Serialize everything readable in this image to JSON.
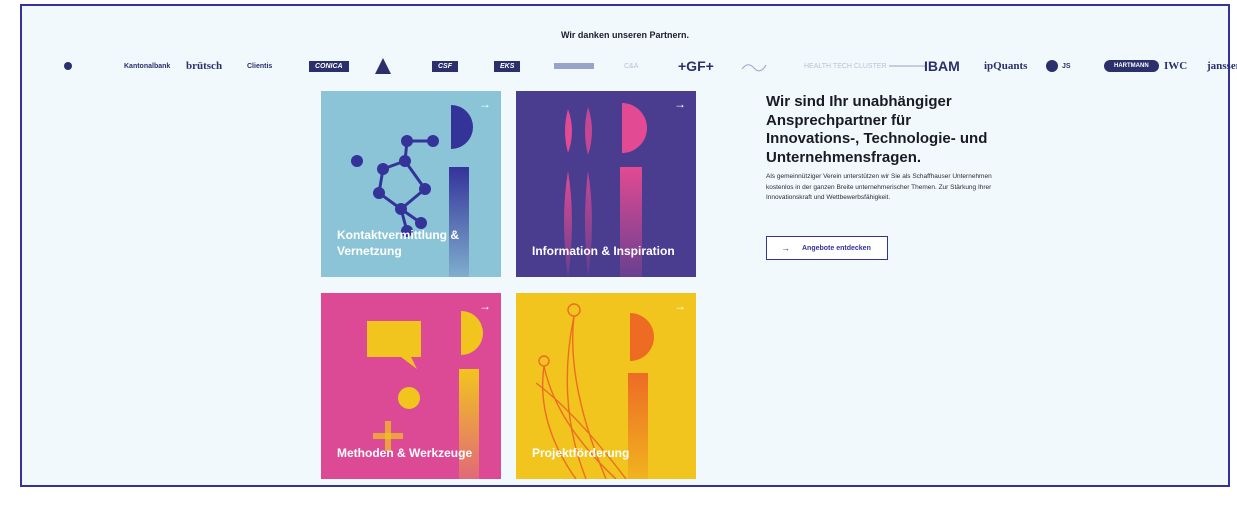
{
  "partners": {
    "title": "Wir danken unseren Partnern.",
    "logos": [
      {
        "id": "logo-1",
        "text": "",
        "style": "dot"
      },
      {
        "id": "logo-2",
        "text": "Kantonalbank",
        "style": "plain"
      },
      {
        "id": "logo-3",
        "text": "brütsch",
        "style": "serif"
      },
      {
        "id": "logo-4",
        "text": "Clientis",
        "style": "plain"
      },
      {
        "id": "logo-5",
        "text": "CONICA",
        "style": "box"
      },
      {
        "id": "logo-6",
        "text": "",
        "style": "tri"
      },
      {
        "id": "logo-7",
        "text": "CSF",
        "style": "box"
      },
      {
        "id": "logo-8",
        "text": "EKS",
        "style": "box"
      },
      {
        "id": "logo-9",
        "text": "",
        "style": "faint"
      },
      {
        "id": "logo-10",
        "text": "C&A",
        "style": "faint"
      },
      {
        "id": "logo-11",
        "text": "+GF+",
        "style": "big"
      },
      {
        "id": "logo-12",
        "text": "",
        "style": "faint"
      },
      {
        "id": "logo-13",
        "text": "HEALTH TECH CLUSTER",
        "style": "faint"
      },
      {
        "id": "logo-14",
        "text": "",
        "style": "faint"
      },
      {
        "id": "logo-15",
        "text": "IBAM",
        "style": "big"
      },
      {
        "id": "logo-16",
        "text": "ipQuants",
        "style": "serif"
      },
      {
        "id": "logo-17",
        "text": "JS",
        "style": "dot"
      },
      {
        "id": "logo-18",
        "text": "HARTMANN",
        "style": "pill"
      },
      {
        "id": "logo-19",
        "text": "IWC",
        "style": "serif"
      },
      {
        "id": "logo-20",
        "text": "janssen",
        "style": "serif"
      }
    ]
  },
  "tiles": [
    {
      "label": "Kontaktvermittlung & Vernetzung",
      "arrow": "→",
      "color": "#8cc4d7"
    },
    {
      "label": "Information & Inspiration",
      "arrow": "→",
      "color": "#4a3d8f"
    },
    {
      "label": "Methoden & Werkzeuge",
      "arrow": "→",
      "color": "#dc4a96"
    },
    {
      "label": "Projektförderung",
      "arrow": "→",
      "color": "#f1c51e"
    }
  ],
  "intro": {
    "headline": "Wir sind Ihr unabhängiger Ansprechpartner für Innovations-, Technologie- und Unternehmensfragen.",
    "body": "Als gemeinnütziger Verein unterstützen wir Sie als Schaffhauser Unternehmen kostenlos in der ganzen Breite unternehmerischer Themen. Zur Stärkung Ihrer Innovationskraft und Wettbewerbsfähigkeit.",
    "cta_arrow": "→",
    "cta_label": "Angebote entdecken"
  },
  "colors": {
    "accent": "#34339a",
    "background": "#f1f9fd"
  }
}
